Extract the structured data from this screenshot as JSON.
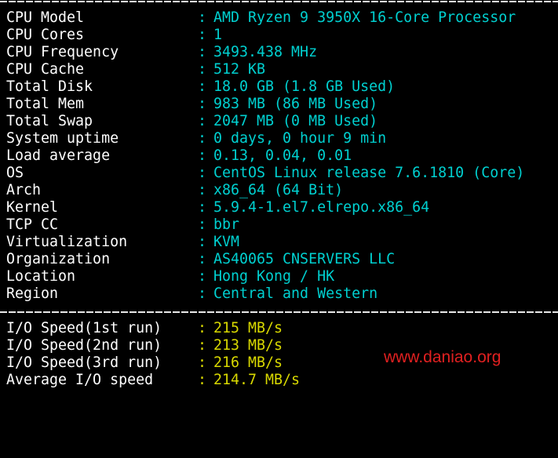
{
  "separator": ":",
  "colors": {
    "background": "#000000",
    "key": "#ffffff",
    "value": "#00d0d0",
    "io_value": "#d9d900",
    "watermark": "#e02020",
    "divider": "#e8e8e8"
  },
  "system_info": [
    {
      "key": "CPU Model",
      "value": "AMD Ryzen 9 3950X 16-Core Processor"
    },
    {
      "key": "CPU Cores",
      "value": "1"
    },
    {
      "key": "CPU Frequency",
      "value": "3493.438 MHz"
    },
    {
      "key": "CPU Cache",
      "value": "512 KB"
    },
    {
      "key": "Total Disk",
      "value": "18.0 GB (1.8 GB Used)"
    },
    {
      "key": "Total Mem",
      "value": "983 MB (86 MB Used)"
    },
    {
      "key": "Total Swap",
      "value": "2047 MB (0 MB Used)"
    },
    {
      "key": "System uptime",
      "value": "0 days, 0 hour 9 min"
    },
    {
      "key": "Load average",
      "value": "0.13, 0.04, 0.01"
    },
    {
      "key": "OS",
      "value": "CentOS Linux release 7.6.1810 (Core)"
    },
    {
      "key": "Arch",
      "value": "x86_64 (64 Bit)"
    },
    {
      "key": "Kernel",
      "value": "5.9.4-1.el7.elrepo.x86_64"
    },
    {
      "key": "TCP CC",
      "value": "bbr"
    },
    {
      "key": "Virtualization",
      "value": "KVM"
    },
    {
      "key": "Organization",
      "value": "AS40065 CNSERVERS LLC"
    },
    {
      "key": "Location",
      "value": "Hong Kong / HK"
    },
    {
      "key": "Region",
      "value": "Central and Western"
    }
  ],
  "io_speed": [
    {
      "key": "I/O Speed(1st run)",
      "value": "215 MB/s"
    },
    {
      "key": "I/O Speed(2nd run)",
      "value": "213 MB/s"
    },
    {
      "key": "I/O Speed(3rd run)",
      "value": "216 MB/s"
    },
    {
      "key": "Average I/O speed",
      "value": "214.7 MB/s"
    }
  ],
  "watermark": "www.daniao.org"
}
